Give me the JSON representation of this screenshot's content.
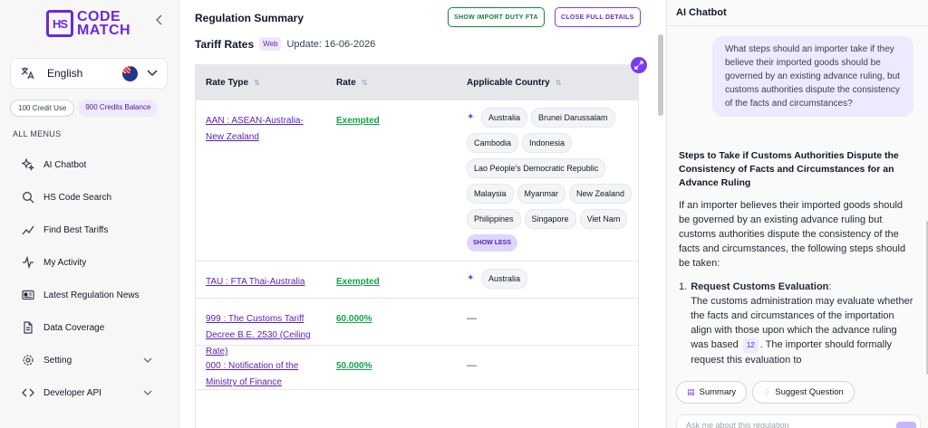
{
  "brand": {
    "logo_mark": "HS",
    "line1": "CODE",
    "line2": "MATCH"
  },
  "sidebar": {
    "language": "English",
    "credit_use": "100 Credit Use",
    "credit_balance": "900 Credits Balance",
    "menus_title": "ALL MENUS",
    "items": [
      {
        "label": "AI Chatbot",
        "icon": "sparkle-icon"
      },
      {
        "label": "HS Code Search",
        "icon": "search-icon"
      },
      {
        "label": "Find Best Tariffs",
        "icon": "trend-icon"
      },
      {
        "label": "My Activity",
        "icon": "activity-icon"
      },
      {
        "label": "Latest Regulation News",
        "icon": "news-icon"
      },
      {
        "label": "Data Coverage",
        "icon": "document-icon"
      },
      {
        "label": "Setting",
        "icon": "gear-icon",
        "expandable": true
      },
      {
        "label": "Developer API",
        "icon": "code-icon",
        "expandable": true
      }
    ]
  },
  "main": {
    "title": "Regulation Summary",
    "btn_import_duty": "SHOW IMPORT DUTY FTA",
    "btn_close_details": "CLOSE FULL DETAILS",
    "tariff_title": "Tariff Rates",
    "web_tag": "Web",
    "update": "Update: 16-06-2026",
    "columns": [
      "Rate Type",
      "Rate",
      "Applicable Country"
    ],
    "rows": [
      {
        "rate_type": "AAN : ASEAN-Australia-New Zealand",
        "rate": "Exempted",
        "countries": [
          "Australia",
          "Brunei Darussalam",
          "Cambodia",
          "Indonesia",
          "Lao People's Democratic Republic",
          "Malaysia",
          "Myanmar",
          "New Zealand",
          "Philippines",
          "Singapore",
          "Viet Nam"
        ],
        "show_less": "SHOW LESS"
      },
      {
        "rate_type": "TAU : FTA Thai-Australia",
        "rate": "Exempted",
        "countries": [
          "Australia"
        ]
      },
      {
        "rate_type": "999 : The Customs Tariff Decree B.E. 2530 (Ceiling Rate)",
        "rate": "60.000%",
        "countries_text": "—"
      },
      {
        "rate_type": "000 : Notification of the Ministry of Finance",
        "rate": "50.000%",
        "countries_text": "—"
      }
    ]
  },
  "chat": {
    "title": "AI Chatbot",
    "user_message": "What steps should an importer take if they believe their imported goods should be governed by an existing advance ruling, but customs authorities dispute the consistency of the facts and circumstances?",
    "answer_heading": "Steps to Take if Customs Authorities Dispute the Consistency of Facts and Circumstances for an Advance Ruling",
    "answer_intro": "If an importer believes their imported goods should be governed by an existing advance ruling but customs authorities dispute the consistency of the facts and circumstances, the following steps should be taken:",
    "step1_num": "1.",
    "step1_title": "Request Customs Evaluation",
    "step1_colon": ":",
    "step1_body_a": "The customs administration may evaluate whether the facts and circumstances of the importation align with those upon which the advance ruling was based",
    "step1_ref": "12",
    "step1_body_b": ". The importer should formally request this evaluation to",
    "btn_summary": "Summary",
    "btn_suggest": "Suggest Question",
    "input_placeholder": "Ask me about this regulation"
  }
}
